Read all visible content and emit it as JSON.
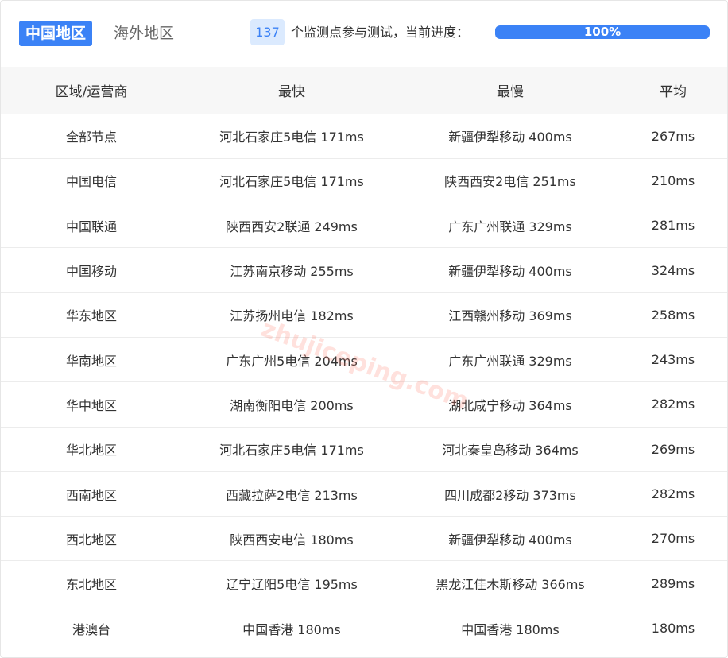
{
  "tabs": [
    {
      "label": "中国地区",
      "active": true
    },
    {
      "label": "海外地区",
      "active": false
    }
  ],
  "status": {
    "node_count": "137",
    "text": "个监测点参与测试，当前进度：",
    "progress_label": "100%",
    "progress_value": 1.0
  },
  "colors": {
    "accent": "#3b82f6",
    "badge_bg": "#dbeafe",
    "header_bg": "#f7f7f7"
  },
  "table": {
    "headers": [
      "区域/运营商",
      "最快",
      "最慢",
      "平均"
    ],
    "rows": [
      [
        "全部节点",
        "河北石家庄5电信 171ms",
        "新疆伊犁移动 400ms",
        "267ms"
      ],
      [
        "中国电信",
        "河北石家庄5电信 171ms",
        "陕西西安2电信 251ms",
        "210ms"
      ],
      [
        "中国联通",
        "陕西西安2联通 249ms",
        "广东广州联通 329ms",
        "281ms"
      ],
      [
        "中国移动",
        "江苏南京移动 255ms",
        "新疆伊犁移动 400ms",
        "324ms"
      ],
      [
        "华东地区",
        "江苏扬州电信 182ms",
        "江西赣州移动 369ms",
        "258ms"
      ],
      [
        "华南地区",
        "广东广州5电信 204ms",
        "广东广州联通 329ms",
        "243ms"
      ],
      [
        "华中地区",
        "湖南衡阳电信 200ms",
        "湖北咸宁移动 364ms",
        "282ms"
      ],
      [
        "华北地区",
        "河北石家庄5电信 171ms",
        "河北秦皇岛移动 364ms",
        "269ms"
      ],
      [
        "西南地区",
        "西藏拉萨2电信 213ms",
        "四川成都2移动 373ms",
        "282ms"
      ],
      [
        "西北地区",
        "陕西西安电信 180ms",
        "新疆伊犁移动 400ms",
        "270ms"
      ],
      [
        "东北地区",
        "辽宁辽阳5电信 195ms",
        "黑龙江佳木斯移动 366ms",
        "289ms"
      ],
      [
        "港澳台",
        "中国香港 180ms",
        "中国香港 180ms",
        "180ms"
      ]
    ]
  },
  "watermark": "zhujiceping.com"
}
